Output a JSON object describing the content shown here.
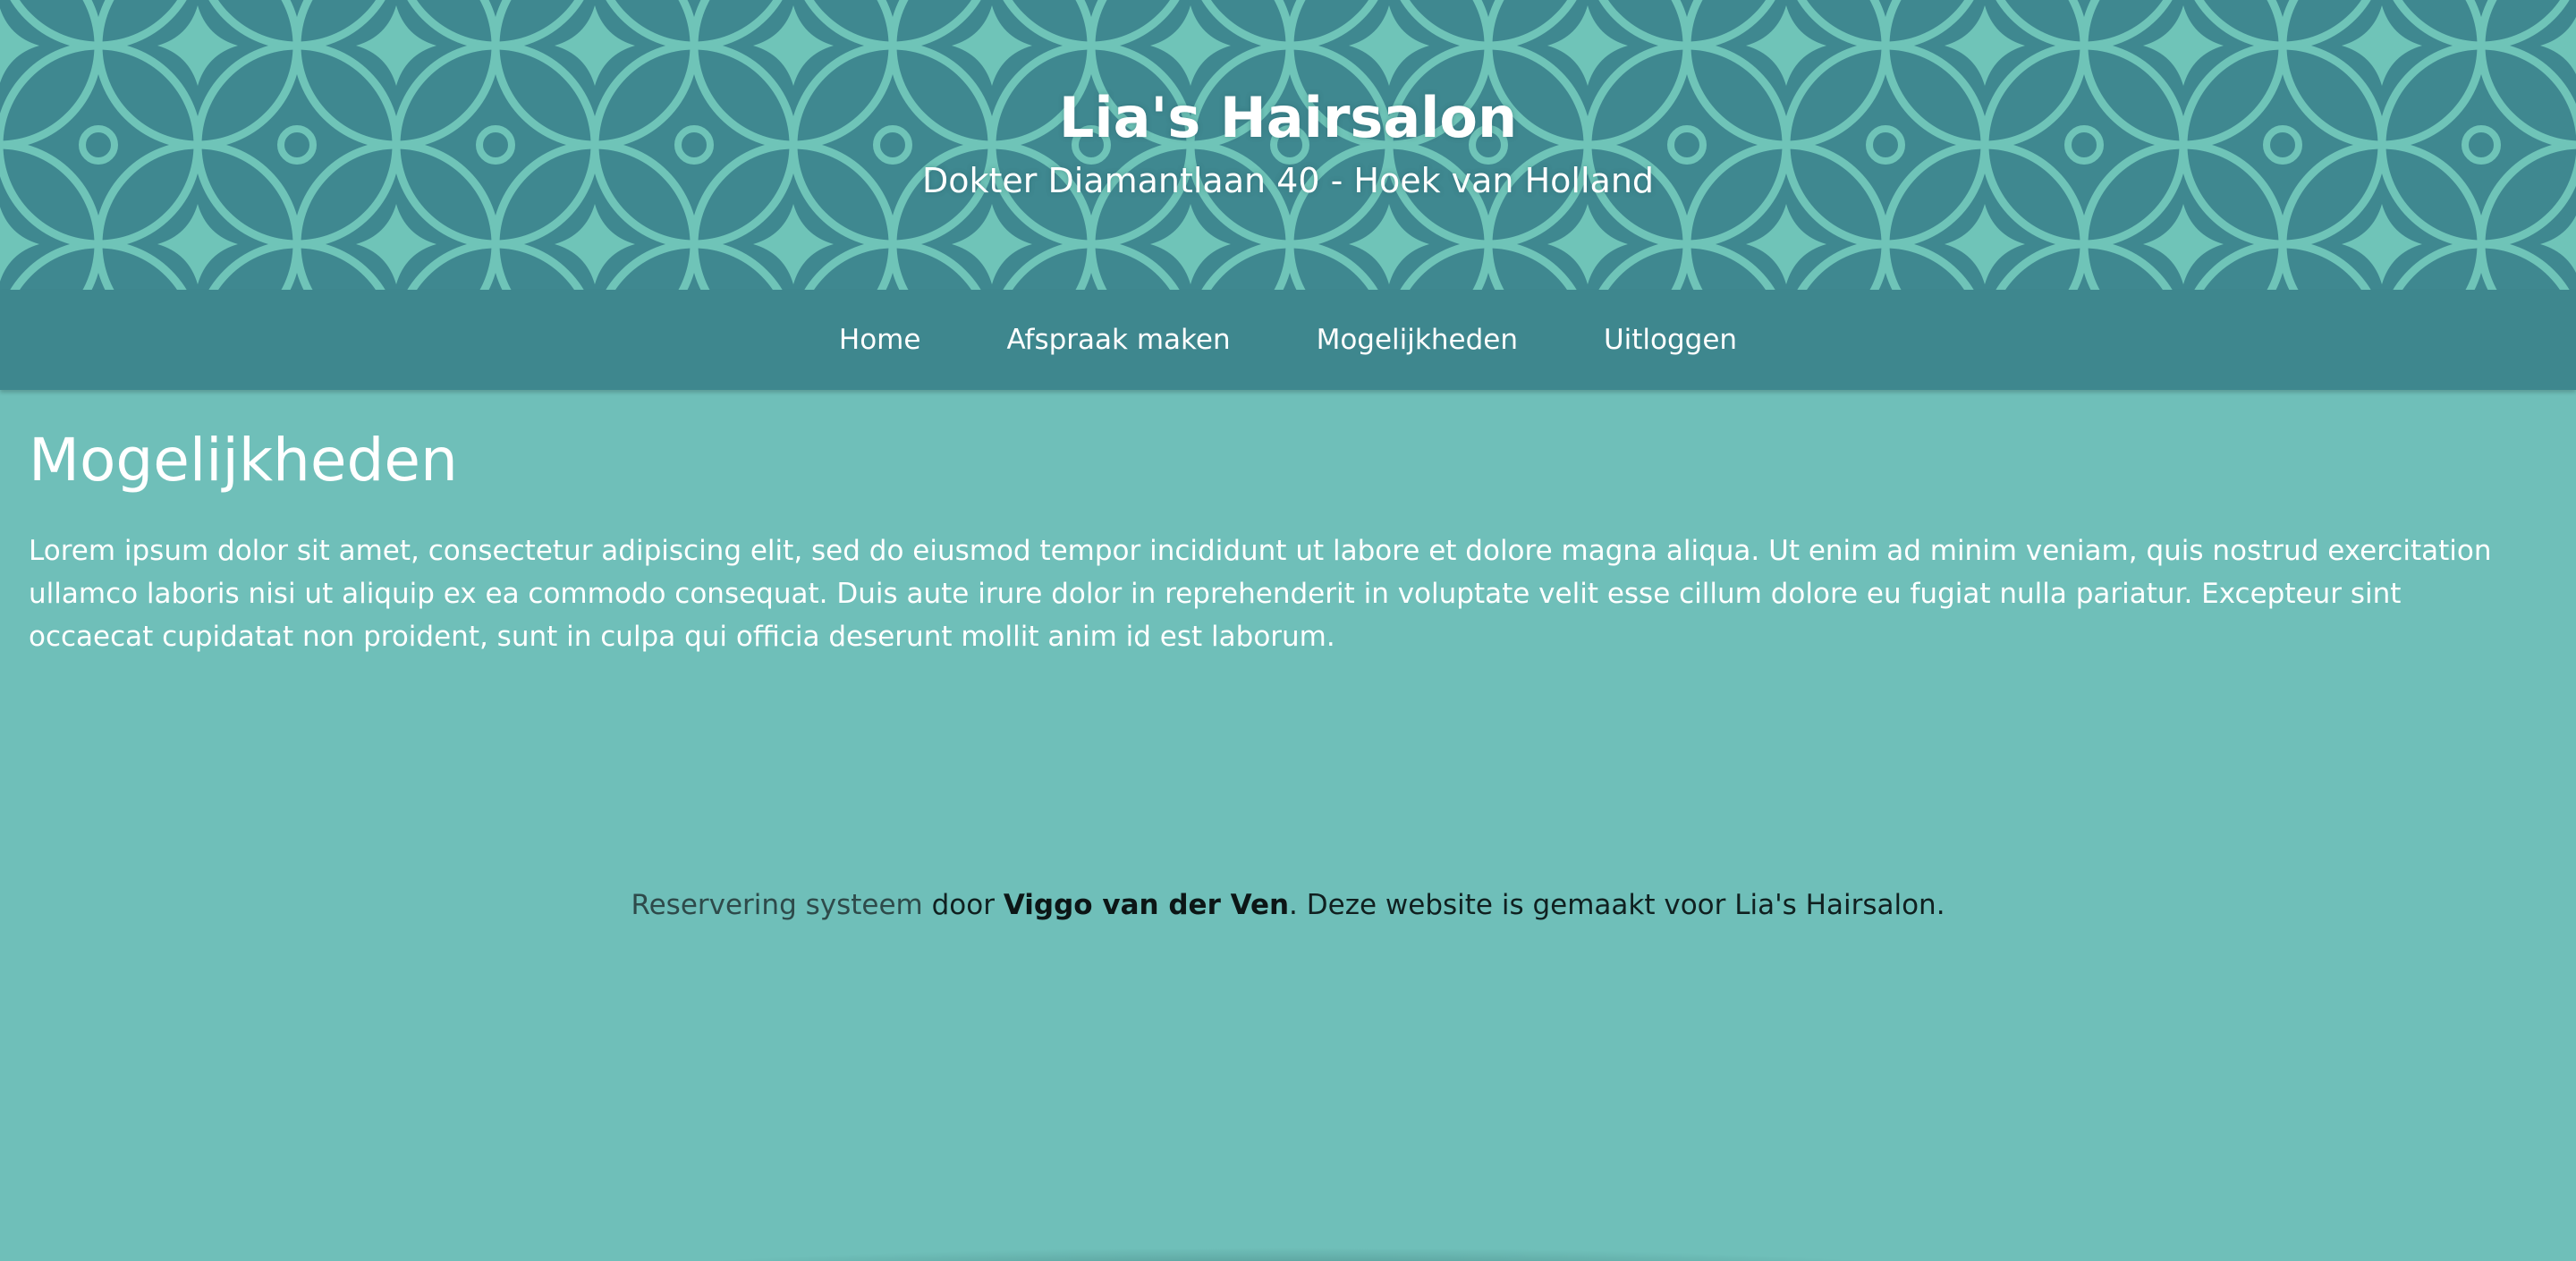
{
  "header": {
    "title": "Lia's Hairsalon",
    "subtitle": "Dokter Diamantlaan 40 - Hoek van Holland"
  },
  "nav": {
    "items": [
      {
        "label": "Home"
      },
      {
        "label": "Afspraak maken"
      },
      {
        "label": "Mogelijkheden"
      },
      {
        "label": "Uitloggen"
      }
    ]
  },
  "main": {
    "heading": "Mogelijkheden",
    "paragraph": "Lorem ipsum dolor sit amet, consectetur adipiscing elit, sed do eiusmod tempor incididunt ut labore et dolore magna aliqua. Ut enim ad minim veniam, quis nostrud exercitation ullamco laboris nisi ut aliquip ex ea commodo consequat. Duis aute irure dolor in reprehenderit in voluptate velit esse cillum dolore eu fugiat nulla pariatur. Excepteur sint occaecat cupidatat non proident, sunt in culpa qui officia deserunt mollit anim id est laborum."
  },
  "footer": {
    "link_text": "Reservering systeem",
    "by_text": " door ",
    "author": "Viggo van der Ven",
    "closing_text": ". Deze website is gemaakt voor Lia's Hairsalon."
  },
  "colors": {
    "banner_dark": "#3f8890",
    "pattern_light": "#6fc4b8",
    "navbar": "#3e878e",
    "page_background": "#6fbfb9",
    "text_light": "#ffffff"
  }
}
